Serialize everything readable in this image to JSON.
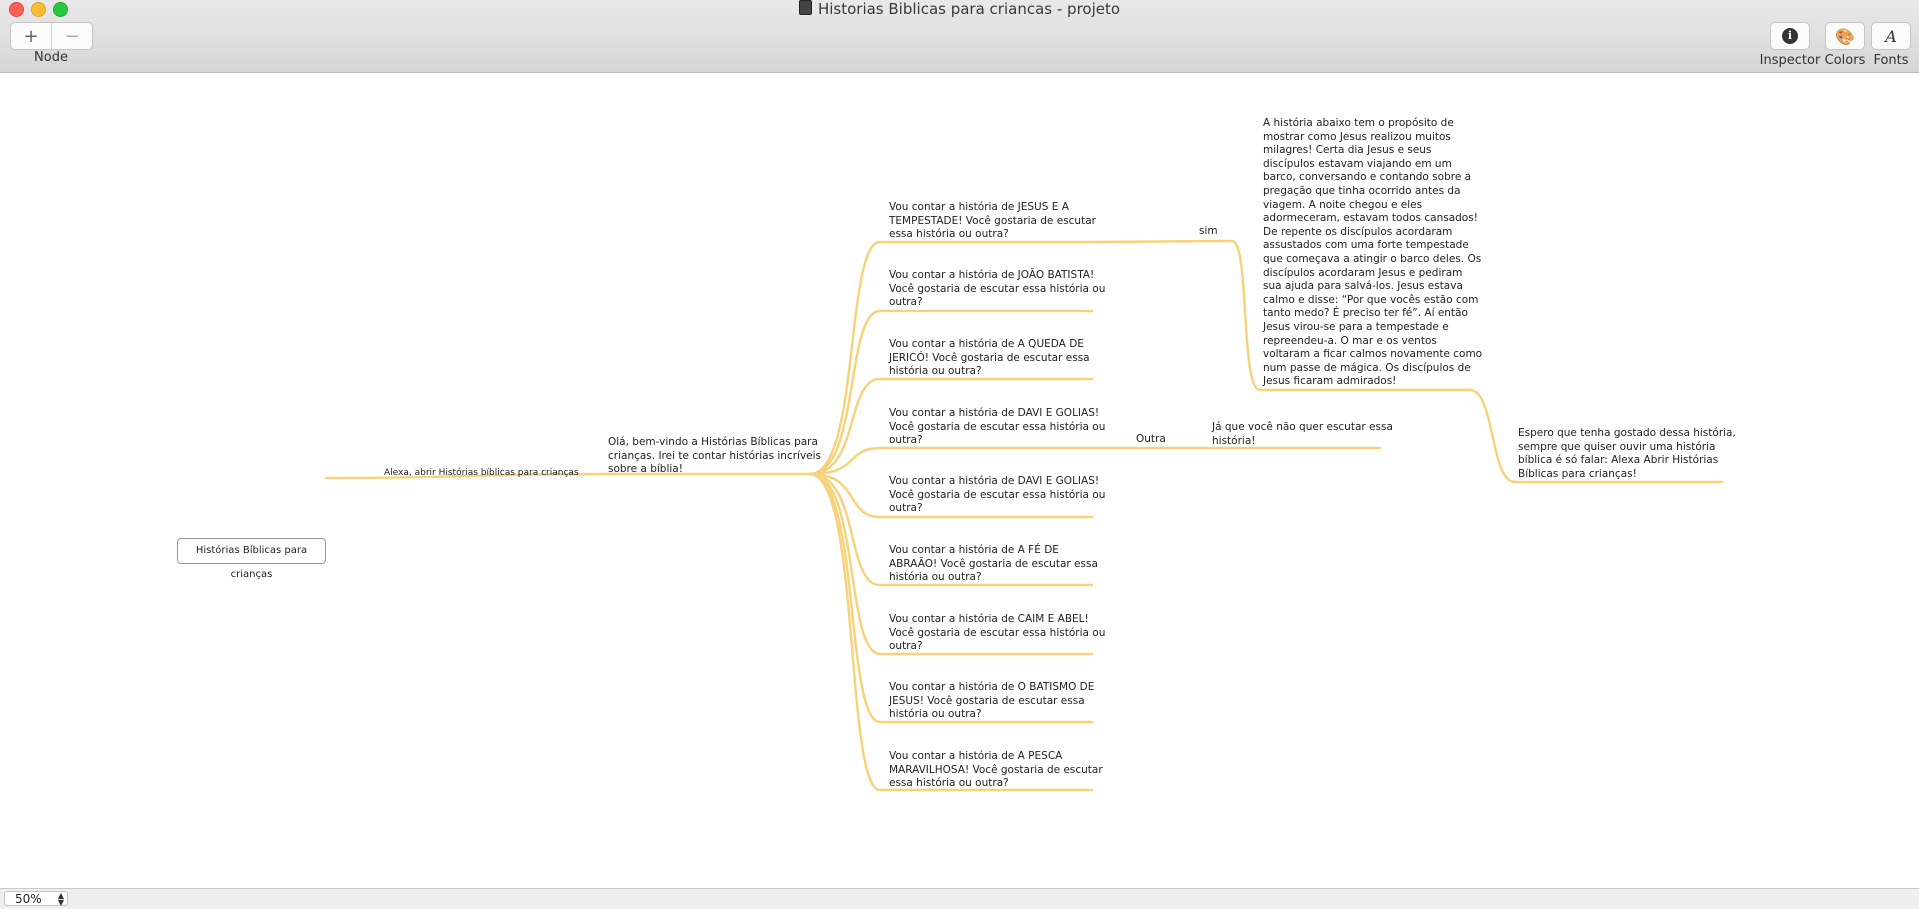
{
  "window": {
    "title": "Historias Biblicas para criancas - projeto"
  },
  "toolbar": {
    "add_glyph": "+",
    "remove_glyph": "−",
    "node_label": "Node",
    "inspector_label": "Inspector",
    "colors_label": "Colors",
    "fonts_label": "Fonts",
    "inspector_glyph": "i",
    "fonts_glyph": "A"
  },
  "icons": [
    "document-icon",
    "plus-icon",
    "minus-icon",
    "info-icon",
    "palette-icon",
    "font-icon",
    "stepper-icon"
  ],
  "branch_color": "#f7d27a",
  "mindmap": {
    "root": "Histórias Bíblicas para crianças",
    "edge_trigger": "Alexa, abrir Histórias bíblicas para crianças",
    "welcome": [
      "Olá, bem-vindo a Histórias Bíblicas para",
      "crianças. Irei te contar histórias incríveis",
      "sobre a bíblia!"
    ],
    "stories": [
      [
        "Vou contar a história de JESUS E A",
        "TEMPESTADE! Você gostaria de escutar",
        "essa história ou outra?"
      ],
      [
        "Vou contar a história de JOÃO BATISTA!",
        "Você gostaria de escutar essa história ou",
        "outra?"
      ],
      [
        "Vou contar a história de A QUEDA DE",
        "JERICÓ! Você gostaria de escutar essa",
        "história ou outra?"
      ],
      [
        "Vou contar a história de DAVI E GOLIAS!",
        "Você gostaria de escutar essa história ou",
        "outra?"
      ],
      [
        "Vou contar a história de DAVI E GOLIAS!",
        "Você gostaria de escutar essa história ou",
        "outra?"
      ],
      [
        "Vou contar a história de A FÉ DE",
        "ABRAÃO! Você gostaria de escutar essa",
        "história ou outra?"
      ],
      [
        "Vou contar a história de CAIM E ABEL!",
        "Você gostaria de escutar essa história ou",
        "outra?"
      ],
      [
        "Vou contar a história de O BATISMO DE",
        "JESUS! Você gostaria de escutar essa",
        "história ou outra?"
      ],
      [
        "Vou contar a história de A PESCA",
        "MARAVILHOSA! Você gostaria de escutar",
        "essa história ou outra?"
      ]
    ],
    "edge_sim": "sim",
    "edge_outra": "Outra",
    "tempestade_story": [
      "A história abaixo tem o propósito de",
      "mostrar como Jesus realizou muitos",
      "milagres! Certa dia Jesus e seus",
      "discípulos estavam viajando em um",
      "barco, conversando e contando sobre a",
      "pregação que tinha ocorrido antes da",
      "viagem. A noite chegou e eles",
      "adormeceram, estavam todos cansados!",
      "De repente os discípulos acordaram",
      "assustados com uma forte tempestade",
      "que começava a atingir o barco deles. Os",
      "discípulos acordaram Jesus e pediram",
      "sua ajuda para salvá-los. Jesus estava",
      "calmo e disse: “Por que vocês estão com",
      "tanto medo? É preciso ter fé”. Aí então",
      "Jesus virou-se para a tempestade e",
      "repreendeu-a. O mar e os ventos",
      "voltaram a ficar calmos novamente como",
      "num passe de mágica. Os discípulos de",
      "Jesus ficaram admirados!"
    ],
    "outra_reply": [
      "Já que você não quer escutar essa",
      "história!"
    ],
    "closing": [
      "Espero que tenha gostado dessa história,",
      "sempre que quiser ouvir uma história",
      "bíblica é só falar:  Alexa Abrir Histórias",
      "Bíblicas para crianças!"
    ]
  },
  "status": {
    "zoom": "50%"
  }
}
